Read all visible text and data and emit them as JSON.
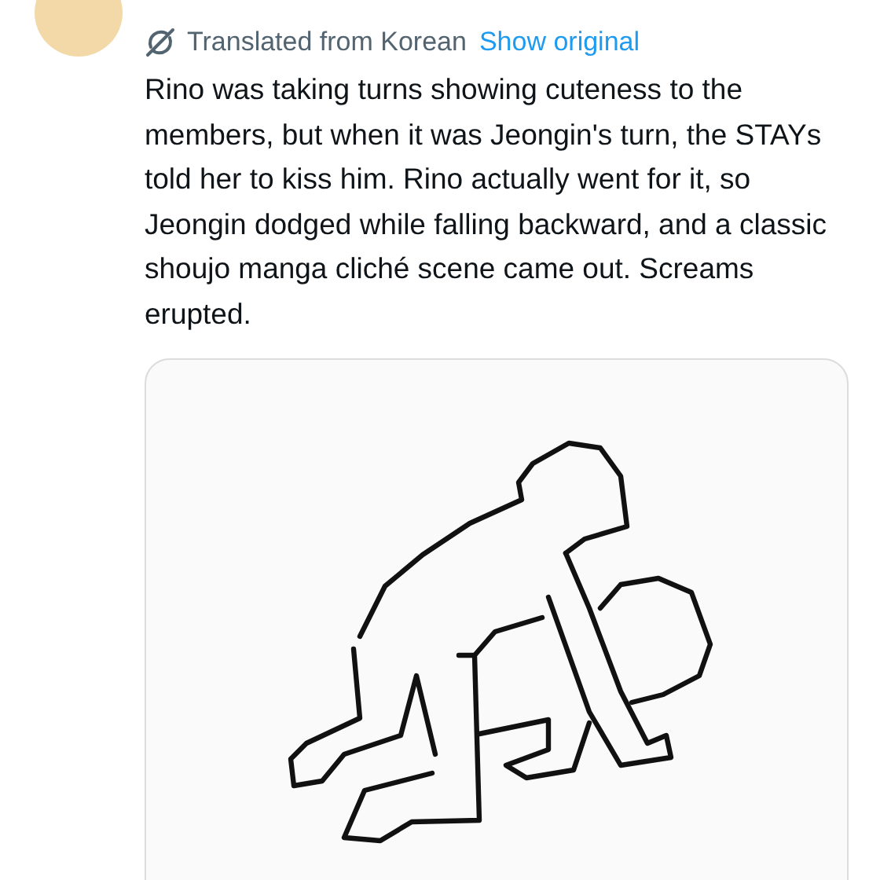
{
  "translation": {
    "label": "Translated from Korean",
    "link": "Show original"
  },
  "tweet_text": "Rino was taking turns showing cuteness to the members, but when it was Jeongin's turn, the STAYs told her to kiss him. Rino actually went for it, so Jeongin dodged while falling backward, and a classic shoujo manga cliché scene came out. Screams erupted."
}
